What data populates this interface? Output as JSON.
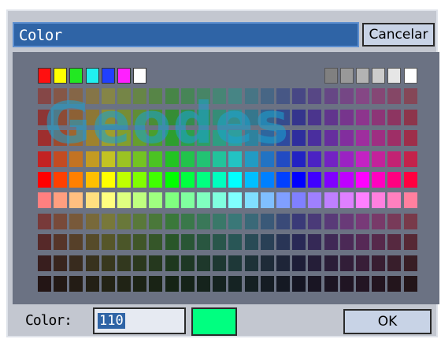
{
  "dialog": {
    "title": "Color",
    "cancel_label": "Cancelar",
    "ok_label": "OK",
    "color_label": "Color:",
    "value": "110",
    "preview_color": "#00ff80",
    "watermark_text": "Geodes"
  },
  "palette": {
    "basic_colors": [
      "#ff1010",
      "#ffff00",
      "#22e822",
      "#20f0f0",
      "#2040ff",
      "#ff20ff",
      "#ffffff"
    ],
    "gray_colors": [
      "#808080",
      "#999999",
      "#b3b3b3",
      "#cccccc",
      "#e6e6e6",
      "#ffffff"
    ],
    "hue_columns": 24,
    "rows": 10
  }
}
